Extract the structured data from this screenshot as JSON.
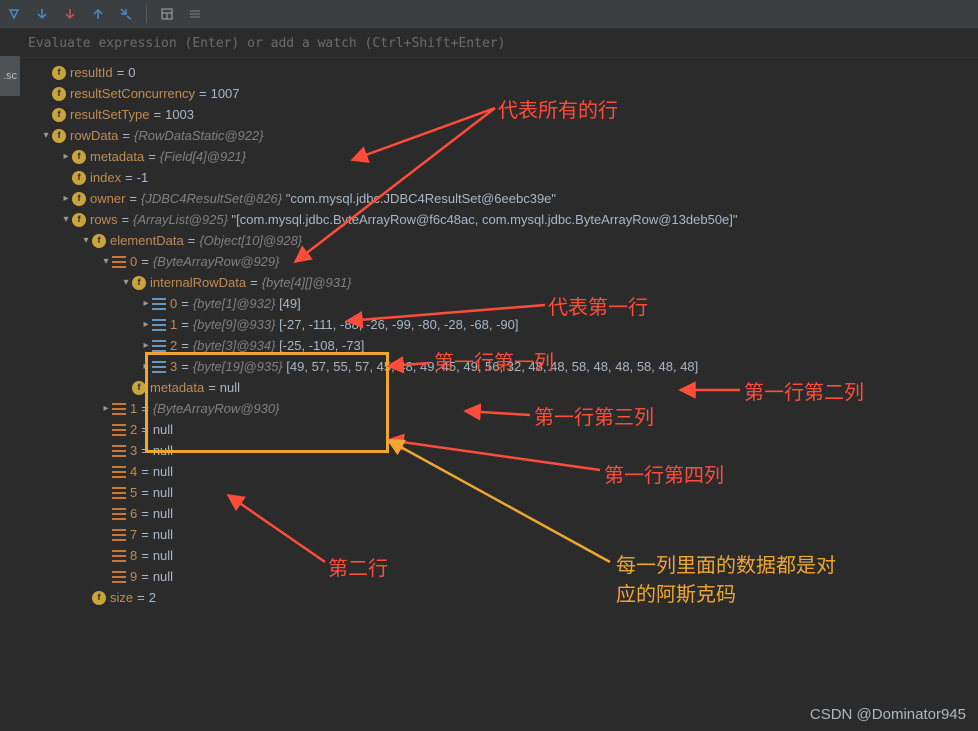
{
  "toolbar_icons": [
    "rerun",
    "step-down-1",
    "step-down-2",
    "step-up",
    "step-out",
    "calculator",
    "settings"
  ],
  "expr_placeholder": "Evaluate expression (Enter) or add a watch (Ctrl+Shift+Enter)",
  "sidebar_tab": ".sc",
  "vars": {
    "resultId": {
      "name": "resultId",
      "value": "0"
    },
    "resultSetConcurrency": {
      "name": "resultSetConcurrency",
      "value": "1007"
    },
    "resultSetType": {
      "name": "resultSetType",
      "value": "1003"
    },
    "rowData": {
      "name": "rowData",
      "type": "{RowDataStatic@922}"
    },
    "metadata": {
      "name": "metadata",
      "type": "{Field[4]@921}"
    },
    "index": {
      "name": "index",
      "value": "-1"
    },
    "owner": {
      "name": "owner",
      "type": "{JDBC4ResultSet@826}",
      "str": "\"com.mysql.jdbc.JDBC4ResultSet@6eebc39e\""
    },
    "rows": {
      "name": "rows",
      "type": "{ArrayList@925}",
      "str": "\"[com.mysql.jdbc.ByteArrayRow@f6c48ac, com.mysql.jdbc.ByteArrayRow@13deb50e]\""
    },
    "elementData": {
      "name": "elementData",
      "type": "{Object[10]@928}"
    },
    "e0": {
      "name": "0",
      "type": "{ByteArrayRow@929}"
    },
    "ird": {
      "name": "internalRowData",
      "type": "{byte[4][]@931}"
    },
    "b0": {
      "name": "0",
      "type": "{byte[1]@932}",
      "arr": "[49]"
    },
    "b1": {
      "name": "1",
      "type": "{byte[9]@933}",
      "arr": "[-27, -111, -88, -26, -99, -80, -28, -68, -90]"
    },
    "b2": {
      "name": "2",
      "type": "{byte[3]@934}",
      "arr": "[-25, -108, -73]"
    },
    "b3": {
      "name": "3",
      "type": "{byte[19]@935}",
      "arr": "[49, 57, 55, 57, 45, 48, 49, 45, 49, 56, 32, 48, 48, 58, 48, 48, 58, 48, 48]"
    },
    "rmeta": {
      "name": "metadata",
      "value": "null"
    },
    "e1": {
      "name": "1",
      "type": "{ByteArrayRow@930}"
    },
    "e2": {
      "name": "2",
      "value": "null"
    },
    "e3": {
      "name": "3",
      "value": "null"
    },
    "e4": {
      "name": "4",
      "value": "null"
    },
    "e5": {
      "name": "5",
      "value": "null"
    },
    "e6": {
      "name": "6",
      "value": "null"
    },
    "e7": {
      "name": "7",
      "value": "null"
    },
    "e8": {
      "name": "8",
      "value": "null"
    },
    "e9": {
      "name": "9",
      "value": "null"
    },
    "size": {
      "name": "size",
      "value": "2"
    }
  },
  "annotations": {
    "all_rows": "代表所有的行",
    "first_row": "代表第一行",
    "r1c1": "第一行第一列",
    "r1c2": "第一行第二列",
    "r1c3": "第一行第三列",
    "r1c4": "第一行第四列",
    "second_row": "第二行",
    "ascii": "每一列里面的数据都是对应的阿斯克码"
  },
  "watermark": "CSDN @Dominator945"
}
